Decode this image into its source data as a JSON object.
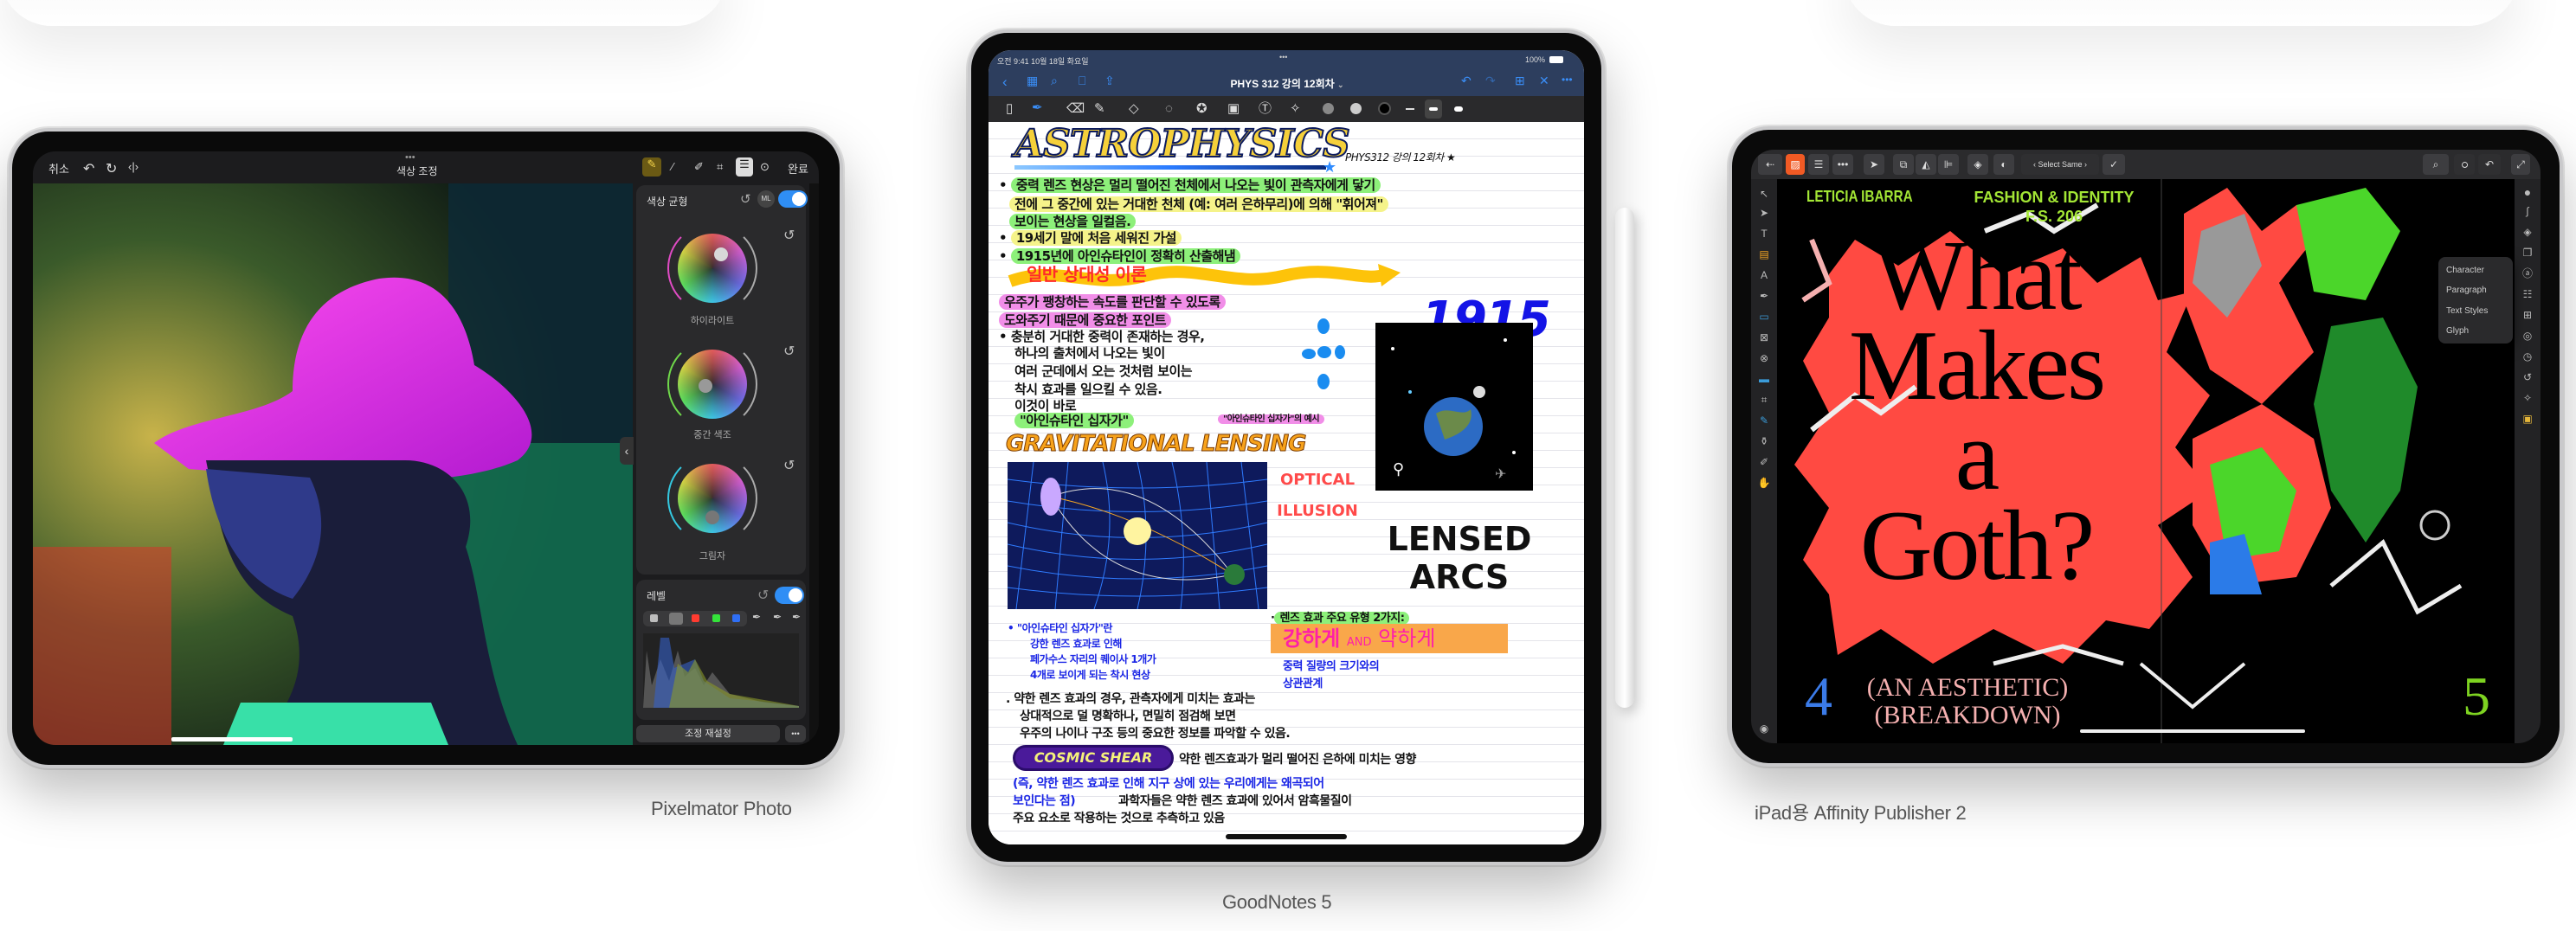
{
  "captions": {
    "pixelmator": "Pixelmator Photo",
    "goodnotes": "GoodNotes 5",
    "affinity": "iPad용 Affinity Publisher 2"
  },
  "pixelmator": {
    "toolbar": {
      "cancel": "취소",
      "title": "색상 조정",
      "done": "완료",
      "icons": [
        "undo-icon",
        "redo-icon",
        "compare-icon",
        "ml-wand-icon",
        "ml-brush-icon",
        "bandage-icon",
        "crop-icon",
        "adjust-icon",
        "more-icon"
      ]
    },
    "color_balance": {
      "title": "색상 균형",
      "ml_label": "ML",
      "enabled": true,
      "wheels": [
        {
          "label": "하이라이트"
        },
        {
          "label": "중간 색조"
        },
        {
          "label": "그림자"
        }
      ]
    },
    "levels": {
      "title": "레벨",
      "enabled": true,
      "channels": [
        "gray",
        "rgb",
        "red",
        "green",
        "blue"
      ],
      "channel_colors": [
        "#bdbdbd",
        "#ffffff",
        "#ff3b30",
        "#34e33a",
        "#2f6ff5"
      ]
    },
    "reset_button": "조정 재설정",
    "more_button": "•••"
  },
  "goodnotes": {
    "status": {
      "time": "오전 9:41  10월 18일 화요일",
      "battery": "100%"
    },
    "title": "PHYS 312 강의 12회차",
    "accent": "#3a8ef7",
    "notes": {
      "heading": "ASTROPHYSICS",
      "subtitle": "PHYS312 강의 12회차 ★",
      "year": "1915",
      "lines": [
        "중력 렌즈 현상은 멀리 떨어진 천체에서 나오는 빛이 관측자에게 닿기",
        "전에 그 중간에 있는 거대한 천체 (예: 여러 은하무리)에 의해 \"휘어져\"",
        "보이는 현상을 일컬음.",
        "19세기 말에 처음 세워진 가설",
        "1915년에 아인슈타인이 정확히 산출해냄",
        "일반 상대성 이론",
        "우주가 팽창하는 속도를 판단할 수 있도록",
        "도와주기 때문에 중요한 포인트",
        "충분히 거대한 중력이 존재하는 경우,",
        "하나의 출처에서 나오는 빛이",
        "여러 군데에서 오는 것처럼 보이는",
        "착시 효과를 일으킬 수 있음.",
        "이것이 바로",
        "\"아인슈타인 십자가\""
      ],
      "cross_caption": "\"아인슈타인 십자가\"의 예시",
      "grav_lensing": "GRAVITATIONAL LENSING",
      "optical_illusion": "OPTICAL ILLUSION",
      "lensed_arcs": [
        "LENSED",
        "ARCS"
      ],
      "types_heading": "렌즈 효과 주요 유형 2가지:",
      "types": [
        "강하게",
        "AND",
        "약하게"
      ],
      "mass_relation": [
        "중력 질량의 크기와의",
        "상관관계"
      ],
      "cross_def": [
        "\"아인슈타인 십자가\"란",
        "강한 렌즈 효과로 인해",
        "페가수스 자리의 퀘이사 1개가",
        "4개로 보이게 되는 착시 현상"
      ],
      "weak_lines": [
        "약한 렌즈 효과의 경우, 관측자에게 미치는 효과는",
        "상대적으로 덜 명확하나, 면밀히 점검해 보면",
        "우주의 나이나 구조 등의 중요한 정보를 파악할 수 있음."
      ],
      "cosmic_shear": "COSMIC SHEAR",
      "shear_def": "약한 렌즈효과가 멀리 떨어진 은하에 미치는 영향",
      "shear_lines": [
        "(즉, 약한 렌즈 효과로 인해 지구 상에 있는 우리에게는 왜곡되어",
        "보인다는 점)",
        "과학자들은 약한 렌즈 효과에 있어서 암흑물질이",
        "주요 요소로 작용하는 것으로 추측하고 있음"
      ]
    }
  },
  "affinity": {
    "toolbar": {
      "select_same": "Select Same"
    },
    "document": {
      "author": "LETICIA IBARRA",
      "course": "FASHION & IDENTITY",
      "course_code": "F.S. 206",
      "headline": [
        "What",
        "Makes",
        "a",
        "Goth?"
      ],
      "subhead": [
        "(AN AESTHETIC)",
        "(BREAKDOWN)"
      ],
      "page_left": "4",
      "page_right": "5",
      "colors": {
        "accent_red": "#ff4a42",
        "green": "#a3e635",
        "blue": "#3b7be8",
        "pink": "#f5b0b0"
      }
    },
    "context_menu": [
      "Character",
      "Paragraph",
      "Text Styles",
      "Glyph"
    ]
  }
}
